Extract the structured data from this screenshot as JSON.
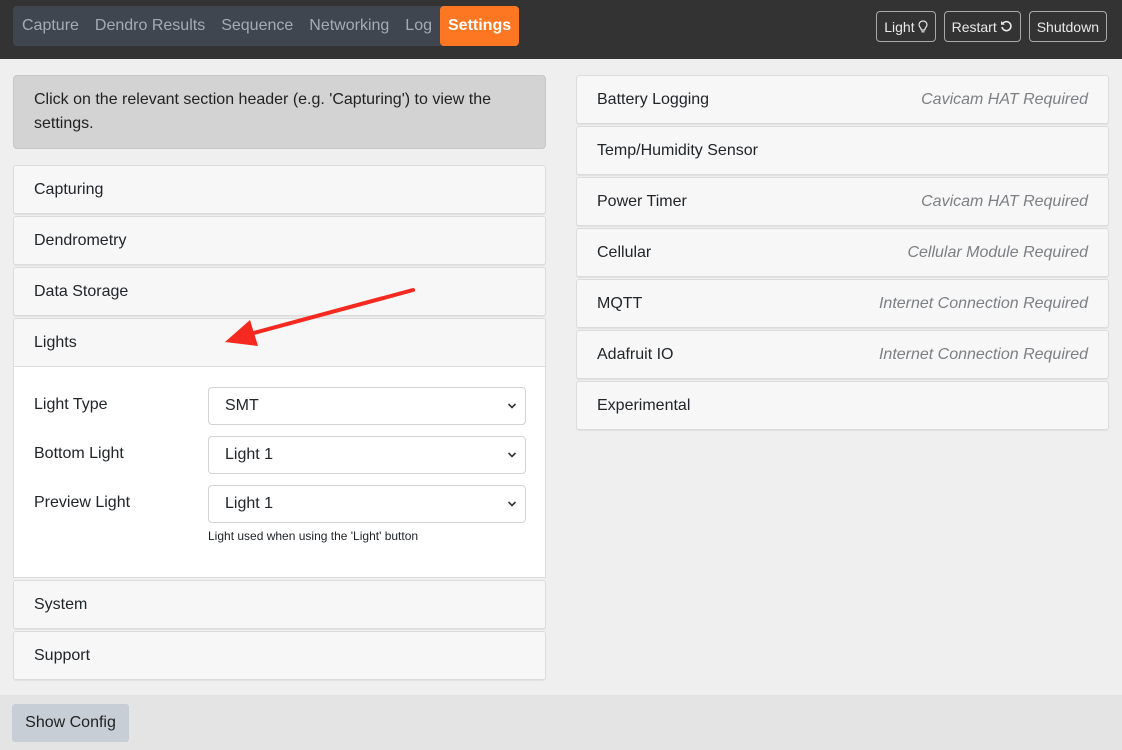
{
  "nav": {
    "tabs": [
      {
        "label": "Capture",
        "active": false
      },
      {
        "label": "Dendro Results",
        "active": false
      },
      {
        "label": "Sequence",
        "active": false
      },
      {
        "label": "Networking",
        "active": false
      },
      {
        "label": "Log",
        "active": false
      },
      {
        "label": "Settings",
        "active": true
      }
    ],
    "buttons": {
      "light": {
        "label": "Light",
        "icon": "lightbulb-icon"
      },
      "restart": {
        "label": "Restart",
        "icon": "restart-icon"
      },
      "shutdown": {
        "label": "Shutdown"
      }
    }
  },
  "left": {
    "info": "Click on the relevant section header (e.g. 'Capturing') to view the settings.",
    "sections": [
      {
        "label": "Capturing"
      },
      {
        "label": "Dendrometry"
      },
      {
        "label": "Data Storage"
      },
      {
        "label": "Lights",
        "expanded": true
      }
    ],
    "lights_form": {
      "light_type": {
        "label": "Light Type",
        "value": "SMT"
      },
      "bottom_light": {
        "label": "Bottom Light",
        "value": "Light 1"
      },
      "preview_light": {
        "label": "Preview Light",
        "value": "Light 1",
        "help": "Light used when using the 'Light' button"
      }
    },
    "sections_after": [
      {
        "label": "System"
      },
      {
        "label": "Support"
      }
    ]
  },
  "right": {
    "sections": [
      {
        "label": "Battery Logging",
        "requirement": "Cavicam HAT Required"
      },
      {
        "label": "Temp/Humidity Sensor",
        "requirement": ""
      },
      {
        "label": "Power Timer",
        "requirement": "Cavicam HAT Required"
      },
      {
        "label": "Cellular",
        "requirement": "Cellular Module Required"
      },
      {
        "label": "MQTT",
        "requirement": "Internet Connection Required"
      },
      {
        "label": "Adafruit IO",
        "requirement": "Internet Connection Required"
      },
      {
        "label": "Experimental",
        "requirement": ""
      }
    ]
  },
  "footer": {
    "show_config_label": "Show Config"
  },
  "colors": {
    "accent": "#fd7722",
    "topbar": "#333333",
    "annotation_arrow": "#f5291f"
  }
}
